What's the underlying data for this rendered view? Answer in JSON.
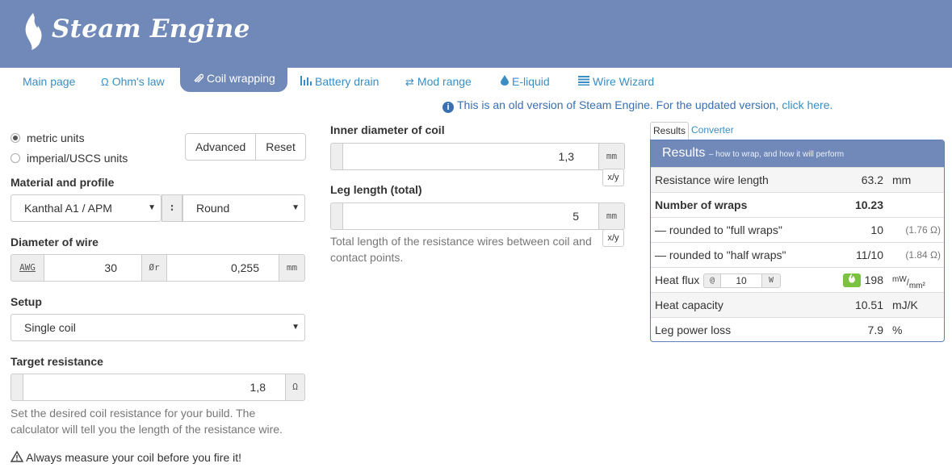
{
  "header": {
    "logo_text": "Steam Engine",
    "logo_icon": "flame-icon"
  },
  "nav": {
    "items": [
      {
        "label": "Main page",
        "icon": ""
      },
      {
        "label": "Ohm's law",
        "icon": "Ω"
      },
      {
        "label": "Coil wrapping",
        "icon": "paperclip-icon",
        "active": true
      },
      {
        "label": "Battery drain",
        "icon": "bar-chart-icon"
      },
      {
        "label": "Mod range",
        "icon": "arrows-icon"
      },
      {
        "label": "E-liquid",
        "icon": "drop-icon"
      },
      {
        "label": "Wire Wizard",
        "icon": "list-icon"
      }
    ]
  },
  "notice": {
    "text": "This is an old version of Steam Engine. For the updated version, ",
    "link": "click here."
  },
  "units": {
    "metric": "metric units",
    "imperial": "imperial/USCS units",
    "selected": "metric"
  },
  "buttons": {
    "advanced": "Advanced",
    "reset": "Reset"
  },
  "material": {
    "label": "Material and profile",
    "wire": "Kanthal A1 / APM",
    "separator": ":",
    "profile": "Round"
  },
  "diameter": {
    "label": "Diameter of wire",
    "awg_label": "AWG",
    "awg_value": "30",
    "diam_symbol": "Ør",
    "mm_value": "0,255",
    "unit": "mm"
  },
  "setup": {
    "label": "Setup",
    "value": "Single coil"
  },
  "target": {
    "label": "Target resistance",
    "value": "1,8",
    "unit": "Ω",
    "help": "Set the desired coil resistance for your build. The calculator will tell you the length of the resistance wire."
  },
  "warning": {
    "text": "Always measure your coil before you fire it!"
  },
  "inner": {
    "label": "Inner diameter of coil",
    "value": "1,3",
    "unit": "mm",
    "toggle": "x/y"
  },
  "leg": {
    "label": "Leg length (total)",
    "value": "5",
    "unit": "mm",
    "toggle": "x/y",
    "help": "Total length of the resistance wires between coil and contact points."
  },
  "results": {
    "tabs": [
      "Results",
      "Converter"
    ],
    "title": "Results",
    "subtitle": "– how to wrap, and how it will perform",
    "rows": [
      {
        "label": "Resistance wire length",
        "value": "63.2",
        "unit": "mm",
        "extra": ""
      },
      {
        "label": "Number of wraps",
        "value": "10.23",
        "unit": "",
        "extra": ""
      },
      {
        "label": "— rounded to \"full wraps\"",
        "value": "10",
        "unit": "",
        "extra": "(1.76 Ω)"
      },
      {
        "label": "— rounded to \"half wraps\"",
        "value": "11/10",
        "unit": "",
        "extra": "(1.84 Ω)"
      },
      {
        "label": "Heat flux",
        "value": "198",
        "unit": "mW/mm²",
        "extra": ""
      },
      {
        "label": "Heat capacity",
        "value": "10.51",
        "unit": "mJ/K",
        "extra": ""
      },
      {
        "label": "Leg power loss",
        "value": "7.9",
        "unit": "%",
        "extra": ""
      }
    ],
    "heat_flux": {
      "at": "@",
      "watts": "10",
      "w_unit": "W",
      "unit_num": "mW",
      "unit_den": "mm²"
    }
  }
}
